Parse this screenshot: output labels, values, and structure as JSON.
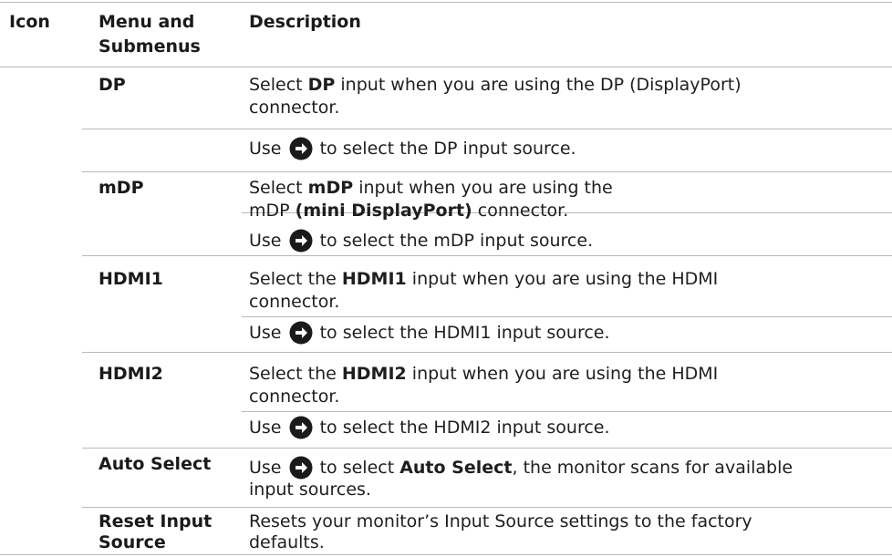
{
  "header": {
    "icon": "Icon",
    "menu_line1": "Menu and",
    "menu_line2": "Submenus",
    "description": "Description"
  },
  "rows": [
    {
      "menu": "DP",
      "desc1_pre": "Select ",
      "desc1_bold": "DP",
      "desc1_line1_post": " input when you are using the DP (DisplayPort)",
      "desc1_line2": "connector.",
      "use_pre": "Use",
      "use_post": "to select the DP input source."
    },
    {
      "menu": "mDP",
      "desc1_pre": "Select ",
      "desc1_bold": "mDP",
      "desc1_line1_post": " input when you are using the",
      "desc1_line2_pre": "mDP ",
      "desc1_line2_bold": "(mini DisplayPort)",
      "desc1_line2_post": " connector.",
      "use_pre": "Use",
      "use_post": "to select the mDP input source."
    },
    {
      "menu": "HDMI1",
      "desc1_pre": "Select the ",
      "desc1_bold": "HDMI1",
      "desc1_line1_post": " input when you are using the HDMI",
      "desc1_line2": "connector.",
      "use_pre": "Use",
      "use_post": "to select the HDMI1 input source."
    },
    {
      "menu": "HDMI2",
      "desc1_pre": "Select the ",
      "desc1_bold": "HDMI2",
      "desc1_line1_post": " input when you are using the HDMI",
      "desc1_line2": "connector.",
      "use_pre": "Use",
      "use_post": "to select the HDMI2 input source."
    },
    {
      "menu": "Auto Select",
      "use_pre": "Use",
      "use_mid": "to select ",
      "use_bold": "Auto Select",
      "use_post": ", the monitor scans for available",
      "line2": "input sources."
    },
    {
      "menu_line1": "Reset Input",
      "menu_line2": "Source",
      "line1": "Resets your monitor’s Input Source settings to the factory",
      "line2": "defaults."
    }
  ],
  "icons": {
    "arrow": "right-arrow-circle-icon"
  },
  "colors": {
    "rule": "#b9b9b9",
    "text": "#1a1a1a",
    "icon": "#1a1a1a"
  }
}
